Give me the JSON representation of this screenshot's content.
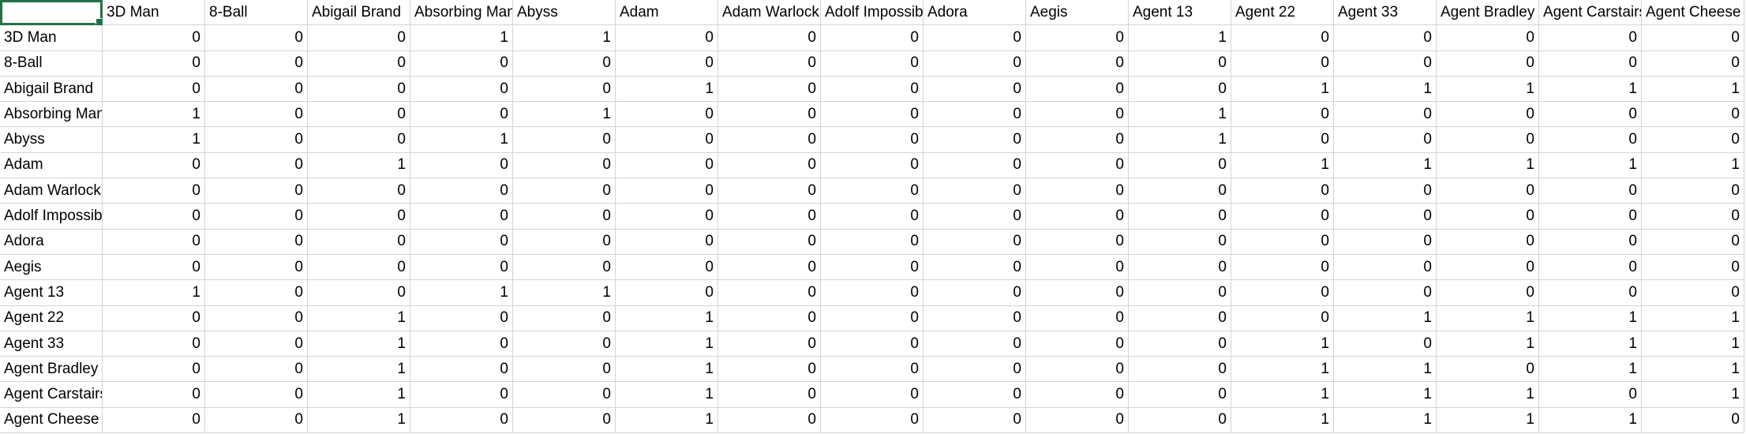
{
  "sheet": {
    "headers": [
      "",
      "3D Man",
      "8-Ball",
      "Abigail Brand",
      "Absorbing Man",
      "Abyss",
      "Adam",
      "Adam Warlock",
      "Adolf Impossible",
      "Adora",
      "Aegis",
      "Agent 13",
      "Agent 22",
      "Agent 33",
      "Agent Bradley",
      "Agent Carstairs",
      "Agent Cheese"
    ],
    "rows": [
      {
        "label": "3D Man",
        "values": [
          0,
          0,
          0,
          1,
          1,
          0,
          0,
          0,
          0,
          0,
          1,
          0,
          0,
          0,
          0,
          0
        ]
      },
      {
        "label": "8-Ball",
        "values": [
          0,
          0,
          0,
          0,
          0,
          0,
          0,
          0,
          0,
          0,
          0,
          0,
          0,
          0,
          0,
          0
        ]
      },
      {
        "label": "Abigail Brand",
        "values": [
          0,
          0,
          0,
          0,
          0,
          1,
          0,
          0,
          0,
          0,
          0,
          1,
          1,
          1,
          1,
          1
        ]
      },
      {
        "label": "Absorbing Man",
        "values": [
          1,
          0,
          0,
          0,
          1,
          0,
          0,
          0,
          0,
          0,
          1,
          0,
          0,
          0,
          0,
          0
        ]
      },
      {
        "label": "Abyss",
        "values": [
          1,
          0,
          0,
          1,
          0,
          0,
          0,
          0,
          0,
          0,
          1,
          0,
          0,
          0,
          0,
          0
        ]
      },
      {
        "label": "Adam",
        "values": [
          0,
          0,
          1,
          0,
          0,
          0,
          0,
          0,
          0,
          0,
          0,
          1,
          1,
          1,
          1,
          1
        ]
      },
      {
        "label": "Adam Warlock",
        "values": [
          0,
          0,
          0,
          0,
          0,
          0,
          0,
          0,
          0,
          0,
          0,
          0,
          0,
          0,
          0,
          0
        ]
      },
      {
        "label": "Adolf Impossible",
        "values": [
          0,
          0,
          0,
          0,
          0,
          0,
          0,
          0,
          0,
          0,
          0,
          0,
          0,
          0,
          0,
          0
        ]
      },
      {
        "label": "Adora",
        "values": [
          0,
          0,
          0,
          0,
          0,
          0,
          0,
          0,
          0,
          0,
          0,
          0,
          0,
          0,
          0,
          0
        ]
      },
      {
        "label": "Aegis",
        "values": [
          0,
          0,
          0,
          0,
          0,
          0,
          0,
          0,
          0,
          0,
          0,
          0,
          0,
          0,
          0,
          0
        ]
      },
      {
        "label": "Agent 13",
        "values": [
          1,
          0,
          0,
          1,
          1,
          0,
          0,
          0,
          0,
          0,
          0,
          0,
          0,
          0,
          0,
          0
        ]
      },
      {
        "label": "Agent 22",
        "values": [
          0,
          0,
          1,
          0,
          0,
          1,
          0,
          0,
          0,
          0,
          0,
          0,
          1,
          1,
          1,
          1
        ]
      },
      {
        "label": "Agent 33",
        "values": [
          0,
          0,
          1,
          0,
          0,
          1,
          0,
          0,
          0,
          0,
          0,
          1,
          0,
          1,
          1,
          1
        ]
      },
      {
        "label": "Agent Bradley",
        "values": [
          0,
          0,
          1,
          0,
          0,
          1,
          0,
          0,
          0,
          0,
          0,
          1,
          1,
          0,
          1,
          1
        ]
      },
      {
        "label": "Agent Carstairs",
        "values": [
          0,
          0,
          1,
          0,
          0,
          1,
          0,
          0,
          0,
          0,
          0,
          1,
          1,
          1,
          0,
          1
        ]
      },
      {
        "label": "Agent Cheese",
        "values": [
          0,
          0,
          1,
          0,
          0,
          1,
          0,
          0,
          0,
          0,
          0,
          1,
          1,
          1,
          1,
          0
        ]
      }
    ]
  },
  "colors": {
    "selection": "#217346",
    "gridline": "#d4d4d4"
  }
}
